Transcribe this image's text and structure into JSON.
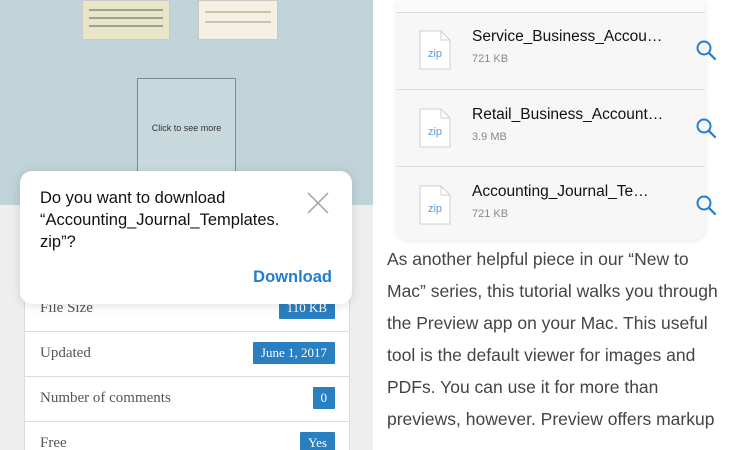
{
  "left": {
    "preview_label": "Click to see more",
    "dialog": {
      "line1": "Do you want to download",
      "line2": "“Accounting_Journal_Templates.",
      "line3": "zip”?",
      "button": "Download"
    },
    "info_rows": [
      {
        "label": "File Size",
        "value": "110 KB"
      },
      {
        "label": "Updated",
        "value": "June 1, 2017"
      },
      {
        "label": "Number of comments",
        "value": "0"
      },
      {
        "label": "Free",
        "value": "Yes"
      }
    ]
  },
  "right": {
    "files": [
      {
        "icon": "zip",
        "name": "Service_Business_Accou…",
        "size": "721 KB"
      },
      {
        "icon": "zip",
        "name": "Retail_Business_Account…",
        "size": "3.9 MB"
      },
      {
        "icon": "zip",
        "name": "Accounting_Journal_Te…",
        "size": "721 KB"
      }
    ],
    "article_lines": [
      "As another helpful piece in our “New to",
      "Mac” series, this tutorial walks you through",
      "the Preview app on your Mac. This useful",
      "tool is the default viewer for images and",
      "PDFs. You can use it for more than",
      "previews, however. Preview offers markup"
    ]
  },
  "colors": {
    "accent": "#1f7fd0",
    "badge": "#2a7fc1"
  }
}
